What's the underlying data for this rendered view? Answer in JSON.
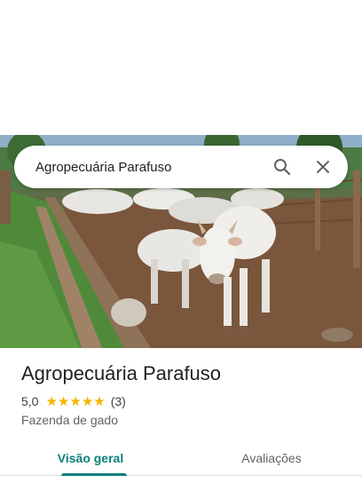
{
  "search": {
    "value": "Agropecuária Parafuso",
    "search_icon": "search-icon",
    "close_icon": "close-icon"
  },
  "place": {
    "name": "Agropecuária Parafuso",
    "rating": "5,0",
    "stars": 5,
    "review_count": "(3)",
    "category": "Fazenda de gado"
  },
  "tabs": [
    {
      "label": "Visão geral",
      "active": true
    },
    {
      "label": "Avaliações",
      "active": false
    }
  ],
  "colors": {
    "accent": "#0b7f7a",
    "star": "#f3b400"
  }
}
